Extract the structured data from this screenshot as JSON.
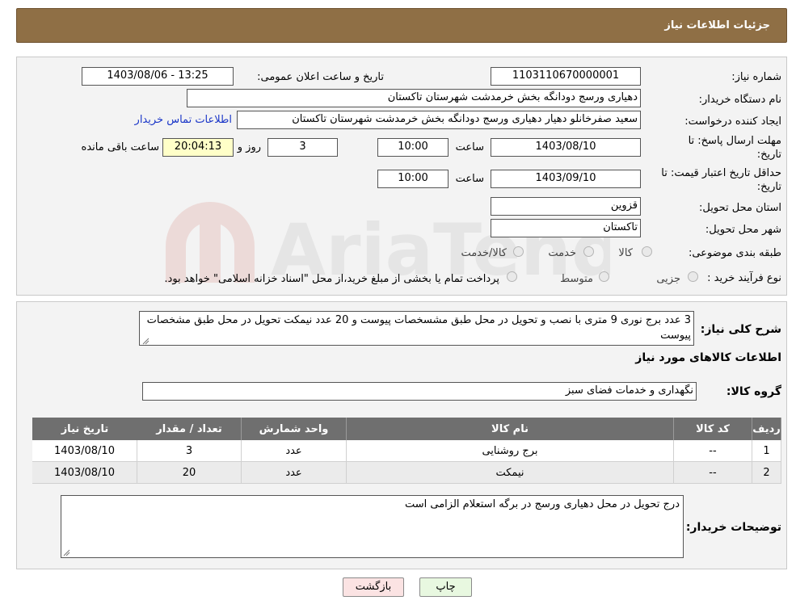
{
  "header": {
    "title": "جزئیات اطلاعات نیاز"
  },
  "fields": {
    "need_number_label": "شماره نیاز:",
    "need_number": "1103110670000001",
    "announce_label": "تاریخ و ساعت اعلان عمومی:",
    "announce_value": "1403/08/06 - 13:25",
    "buyer_org_label": "نام دستگاه خریدار:",
    "buyer_org": "دهیاری ورسج دودانگه بخش خرمدشت شهرستان تاکستان",
    "requester_label": "ایجاد کننده درخواست:",
    "requester": "سعید صفرخانلو دهیار دهیاری ورسج دودانگه بخش خرمدشت شهرستان تاکستان",
    "contact_link": "اطلاعات تماس خریدار",
    "deadline_label_1": "مهلت ارسال پاسخ: تا",
    "deadline_label_2": "تاریخ:",
    "deadline_date": "1403/08/10",
    "time_word": "ساعت",
    "deadline_time": "10:00",
    "days_value": "3",
    "days_word": "روز و",
    "remaining_time": "20:04:13",
    "remaining_word": "ساعت باقی مانده",
    "validity_label_1": "حداقل تاریخ اعتبار قیمت: تا",
    "validity_label_2": "تاریخ:",
    "validity_date": "1403/09/10",
    "validity_time": "10:00",
    "province_label": "استان محل تحویل:",
    "province": "قزوین",
    "city_label": "شهر محل تحویل:",
    "city": "تاکستان",
    "category_label": "طبقه بندی موضوعی:",
    "category_options": [
      "کالا",
      "خدمت",
      "کالا/خدمت"
    ],
    "process_label": "نوع فرآیند خرید :",
    "process_options": [
      "جزیی",
      "متوسط"
    ],
    "process_note": "پرداخت تمام یا بخشی از مبلغ خرید،از محل \"اسناد خزانه اسلامی\" خواهد بود."
  },
  "summary": {
    "label": "شرح کلی نیاز:",
    "text": "3 عدد برج نوری 9 متری با نصب و تحویل در محل طبق مشسخصات پیوست و 20 عدد نیمکت تحویل در محل طبق مشخصات پیوست"
  },
  "goods": {
    "section_title": "اطلاعات کالاهای مورد نیاز",
    "group_label": "گروه کالا:",
    "group_value": "نگهداری و خدمات فضای سبز",
    "columns": [
      "ردیف",
      "کد کالا",
      "نام کالا",
      "واحد شمارش",
      "تعداد / مقدار",
      "تاریخ نیاز"
    ],
    "rows": [
      {
        "row": "1",
        "code": "--",
        "name": "برج روشنایی",
        "unit": "عدد",
        "qty": "3",
        "date": "1403/08/10"
      },
      {
        "row": "2",
        "code": "--",
        "name": "نیمکت",
        "unit": "عدد",
        "qty": "20",
        "date": "1403/08/10"
      }
    ]
  },
  "buyer_notes": {
    "label": "توضیحات خریدار:",
    "text": "درج تحویل در محل دهیاری ورسج در برگه استعلام الزامی است"
  },
  "buttons": {
    "print": "چاپ",
    "back": "بازگشت"
  },
  "watermark": {
    "text": "AriaTender.neT"
  },
  "colors": {
    "header_bg": "#8f6f45",
    "table_header_bg": "#6f6f6f",
    "back_button_bg": "#fbe3e3",
    "print_button_bg": "#e8f8e0"
  }
}
